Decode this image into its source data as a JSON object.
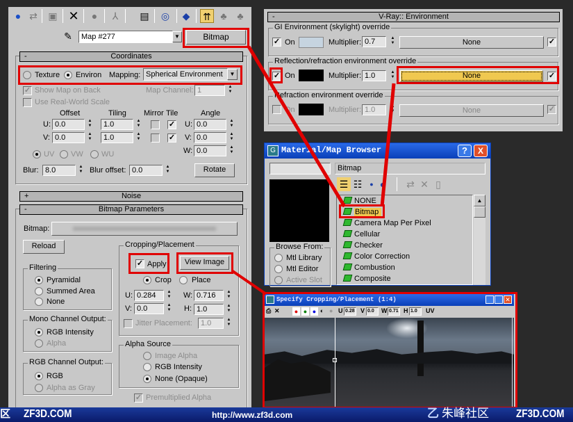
{
  "material_editor": {
    "toolbar_icons": [
      "get-material-icon",
      "put-to-scene-icon",
      "assign-material-icon",
      "reset-map-icon",
      "make-unique-icon",
      "put-to-library-icon",
      "material-effects-channel-icon",
      "show-map-icon",
      "show-end-result-icon",
      "go-to-parent-icon",
      "go-forward-icon",
      "pick-material-icon"
    ],
    "map_name": "Map #277",
    "map_type_button": "Bitmap",
    "coordinates": {
      "header": "Coordinates",
      "collapse": "-",
      "texture": "Texture",
      "environ": "Environ",
      "mapping_label": "Mapping:",
      "mapping_value": "Spherical Environment",
      "show_map_on_back": "Show Map on Back",
      "map_channel_label": "Map Channel:",
      "map_channel": "1",
      "use_real_world": "Use Real-World Scale",
      "offset": "Offset",
      "tiling": "Tiling",
      "mirror": "Mirror",
      "tile": "Tile",
      "angle": "Angle",
      "u": "U:",
      "v": "V:",
      "w": "W:",
      "offset_u": "0.0",
      "offset_v": "0.0",
      "tiling_u": "1.0",
      "tiling_v": "1.0",
      "angle_u": "0.0",
      "angle_v": "0.0",
      "angle_w": "0.0",
      "uv": "UV",
      "vw": "VW",
      "wu": "WU",
      "blur_label": "Blur:",
      "blur": "8.0",
      "blur_offset_label": "Blur offset:",
      "blur_offset": "0.0",
      "rotate": "Rotate"
    },
    "noise": {
      "header": "Noise",
      "expand": "+"
    },
    "bitmap_params": {
      "header": "Bitmap Parameters",
      "collapse": "-",
      "bitmap_label": "Bitmap:",
      "reload": "Reload",
      "filtering": {
        "label": "Filtering",
        "options": [
          "Pyramidal",
          "Summed Area",
          "None"
        ],
        "selected": "Pyramidal"
      },
      "mono": {
        "label": "Mono Channel Output:",
        "options": [
          "RGB Intensity",
          "Alpha"
        ],
        "selected": "RGB Intensity"
      },
      "rgb": {
        "label": "RGB Channel Output:",
        "options": [
          "RGB",
          "Alpha as Gray"
        ],
        "selected": "RGB"
      },
      "cropping": {
        "label": "Cropping/Placement",
        "apply": "Apply",
        "view_image": "View Image",
        "crop": "Crop",
        "place": "Place",
        "u_label": "U:",
        "u": "0.284",
        "v_label": "V:",
        "v": "0.0",
        "w_label": "W:",
        "w": "0.716",
        "h_label": "H:",
        "h": "1.0",
        "jitter": "Jitter Placement:",
        "jitter_value": "1.0"
      },
      "alpha_source": {
        "label": "Alpha Source",
        "options": [
          "Image Alpha",
          "RGB Intensity",
          "None (Opaque)"
        ],
        "selected": "None (Opaque)"
      },
      "premultiplied": "Premultiplied Alpha"
    }
  },
  "vray_env": {
    "header": "V-Ray:: Environment",
    "collapse": "-",
    "groups": [
      {
        "label": "GI Environment (skylight) override",
        "on": "On",
        "checked": true,
        "color": "#c6d4e0",
        "multiplier_label": "Multiplier:",
        "multiplier": "0.7",
        "map": "None",
        "enabled": true
      },
      {
        "label": "Reflection/refraction environment override",
        "on": "On",
        "checked": true,
        "color": "#000000",
        "multiplier_label": "Multiplier:",
        "multiplier": "1.0",
        "map": "None",
        "enabled": true
      },
      {
        "label": "Refraction environment override",
        "on": "On",
        "checked": false,
        "color": "#000000",
        "multiplier_label": "Multiplier:",
        "multiplier": "1.0",
        "map": "None",
        "enabled": false
      }
    ]
  },
  "browser": {
    "title": "Material/Map Browser",
    "help": "?",
    "close": "X",
    "name_field": "Bitmap",
    "browse_from": "Browse From:",
    "browse_options": [
      "Mtl Library",
      "Mtl Editor",
      "Active Slot"
    ],
    "items": [
      "NONE",
      "Bitmap",
      "Camera Map Per Pixel",
      "Cellular",
      "Checker",
      "Color Correction",
      "Combustion",
      "Composite"
    ],
    "selected": "Bitmap"
  },
  "crop_window": {
    "title": "Specify Cropping/Placement  (1:4)",
    "u_label": "U",
    "u": "0.28",
    "v_label": "V",
    "v": "0.0",
    "w_label": "W",
    "w": "0.71",
    "h_label": "H",
    "h": "1.0",
    "uv": "UV"
  },
  "banner": {
    "left_fragment": "区",
    "site1": "ZF3D.COM",
    "url": "http://www.zf3d.com",
    "brand": "朱峰社区",
    "site2": "ZF3D.COM"
  },
  "colors": {
    "highlight": "#f0c850",
    "annotation": "#e00000",
    "title_bar": "#0a3fb8",
    "banner": "#0c2a8a"
  }
}
